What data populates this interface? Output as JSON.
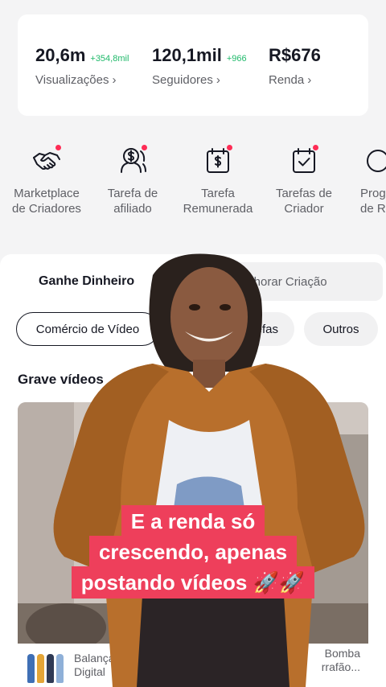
{
  "stats": [
    {
      "value": "20,6m",
      "delta": "+354,8mil",
      "label": "Visualizações"
    },
    {
      "value": "120,1mil",
      "delta": "+966",
      "label": "Seguidores"
    },
    {
      "value": "R$676",
      "delta": "",
      "label": "Renda"
    }
  ],
  "chevron": "›",
  "shortcuts": [
    {
      "icon": "handshake-icon",
      "label": "Marketplace\nde Criadores"
    },
    {
      "icon": "affiliate-dollar-icon",
      "label": "Tarefa de\nafiliado"
    },
    {
      "icon": "calendar-dollar-icon",
      "label": "Tarefa\nRemunerada"
    },
    {
      "icon": "calendar-check-icon",
      "label": "Tarefas de\nCriador"
    },
    {
      "icon": "program-icon",
      "label": "Prog\nde R"
    }
  ],
  "tabs": {
    "active": "Ganhe Dinheiro",
    "inactive": "elhorar Criação"
  },
  "chips": [
    "Comércio de Vídeo",
    "efas",
    "Outros"
  ],
  "section_title": "Grave vídeos",
  "product": {
    "left_text": "Balança\nDigital",
    "right_text": "Bomba\nrrafão..."
  },
  "caption": {
    "line1": "E a renda só",
    "line2": "crescendo,  apenas",
    "line3": "postando vídeos 🚀🚀"
  },
  "colors": {
    "accent_red": "#fe2c55",
    "growth_green": "#1fb96a",
    "caption_bg": "#ee3f5b"
  }
}
